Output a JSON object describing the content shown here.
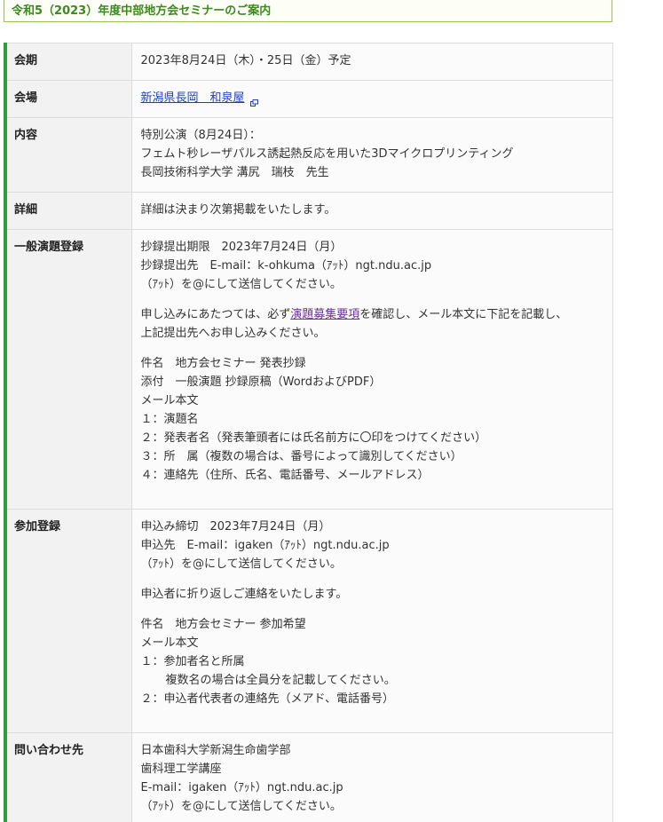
{
  "title": "令和5（2023）年度中部地方会セミナーのご案内",
  "rows": {
    "period": {
      "label": "会期",
      "value": "2023年8月24日（木）・25日（金）予定"
    },
    "venue": {
      "label": "会場",
      "link_text": "新潟県長岡　和泉屋"
    },
    "content": {
      "label": "内容",
      "lines": [
        "特別公演（8月24日）：",
        "フェムト秒レーザパルス誘起熱反応を用いた3Dマイクロプリンティング",
        "長岡技術科学大学 溝尻　瑞枝　先生"
      ]
    },
    "details": {
      "label": "詳細",
      "value": "詳細は決まり次第掲載をいたします。"
    },
    "general_registration": {
      "label": "一般演題登録",
      "deadline": "抄録提出期限　2023年7月24日（月）",
      "submit_to": "抄録提出先　E-mail：k-ohkuma（ｱｯﾄ）ngt.ndu.ac.jp",
      "at_note": "（ｱｯﾄ）を@にして送信してください。",
      "apply_prefix": "申し込みにあたつては、必ず",
      "apply_link": "演題募集要項",
      "apply_suffix": "を確認し、メール本文に下記を記載し、",
      "apply_line2": "上記提出先へお申し込みください。",
      "subject": "件名　地方会セミナー 発表抄録",
      "attachment": "添付　一般演題 抄録原稿（WordおよびPDF）",
      "body_heading": "メール本文",
      "body_items": [
        "１：演題名",
        "２：発表者名（発表筆頭者には氏名前方に〇印をつけてください）",
        "３：所　属（複数の場合は、番号によって識別してください）",
        "４：連絡先（住所、氏名、電話番号、メールアドレス）"
      ]
    },
    "participation": {
      "label": "参加登録",
      "deadline": "申込み締切　2023年7月24日（月）",
      "submit_to": "申込先　E-mail：igaken（ｱｯﾄ）ngt.ndu.ac.jp",
      "at_note": "（ｱｯﾄ）を@にして送信してください。",
      "reply_note": "申込者に折り返しご連絡をいたします。",
      "subject": "件名　地方会セミナー 参加希望",
      "body_heading": "メール本文",
      "item1": "１：参加者名と所属",
      "item1_sub": "複数名の場合は全員分を記載してください。",
      "item2": "２：申込者代表者の連絡先（メアド、電話番号）"
    },
    "contact": {
      "label": "問い合わせ先",
      "lines": [
        "日本歯科大学新潟生命歯学部",
        "歯科理工学講座",
        "E-mail：igaken（ｱｯﾄ）ngt.ndu.ac.jp",
        "（ｱｯﾄ）を@にして送信してください。"
      ]
    }
  },
  "colors": {
    "accent_green": "#2f9e3a",
    "title_green": "#3a8a1e",
    "link_blue": "#1a3fc4",
    "link_visited": "#6b2f99"
  },
  "icons": {
    "external_link": "external-link-icon"
  }
}
